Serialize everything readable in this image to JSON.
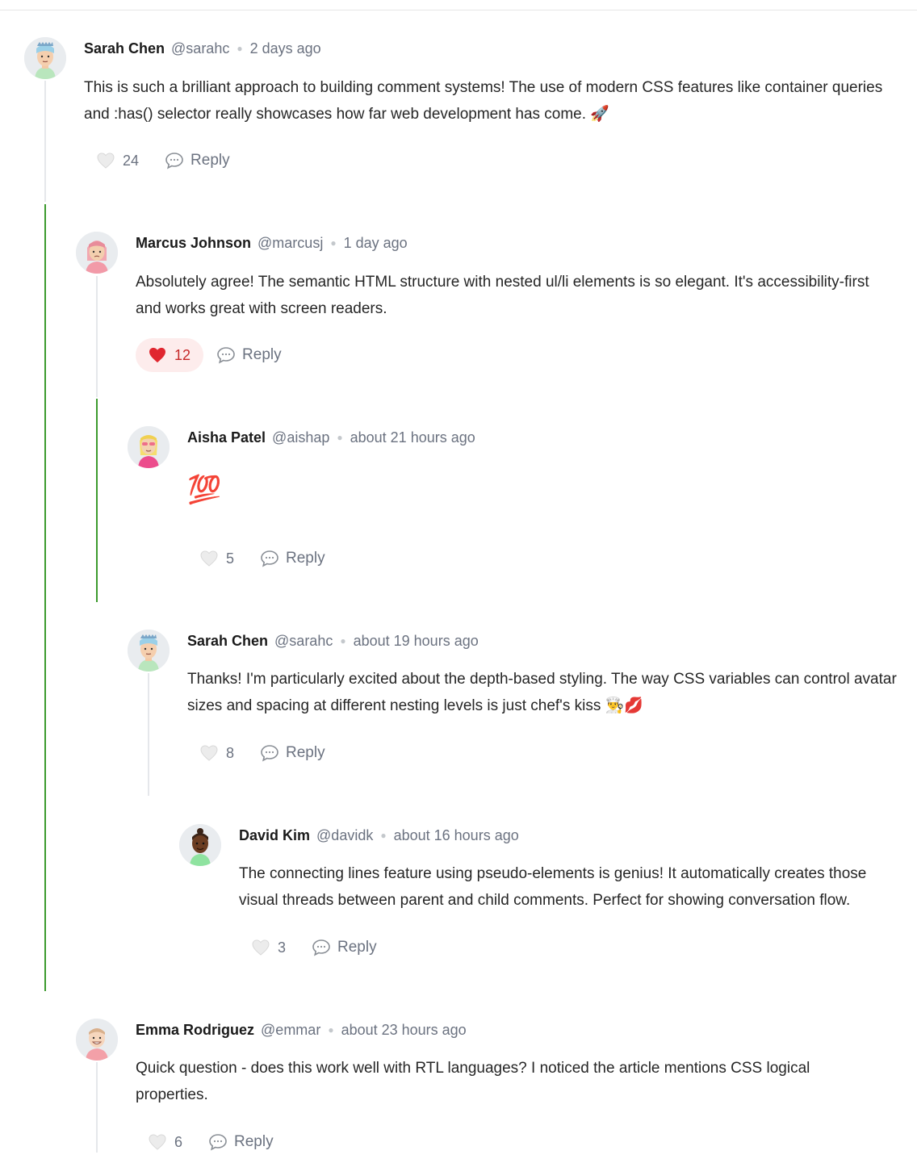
{
  "comments": [
    {
      "name": "Sarah Chen",
      "handle": "@sarahc",
      "time": "2 days ago",
      "text": "This is such a brilliant approach to building comment systems! The use of modern CSS features like container queries and :has() selector really showcases how far web development has come. 🚀",
      "likes": "24",
      "liked": false,
      "reply_label": "Reply"
    },
    {
      "name": "Marcus Johnson",
      "handle": "@marcusj",
      "time": "1 day ago",
      "text": "Absolutely agree! The semantic HTML structure with nested ul/li elements is so elegant. It's accessibility-first and works great with screen readers.",
      "likes": "12",
      "liked": true,
      "reply_label": "Reply"
    },
    {
      "name": "Aisha Patel",
      "handle": "@aishap",
      "time": "about 21 hours ago",
      "text": "💯",
      "likes": "5",
      "liked": false,
      "reply_label": "Reply"
    },
    {
      "name": "Sarah Chen",
      "handle": "@sarahc",
      "time": "about 19 hours ago",
      "text": "Thanks! I'm particularly excited about the depth-based styling. The way CSS variables can control avatar sizes and spacing at different nesting levels is just chef's kiss 👨‍🍳💋",
      "likes": "8",
      "liked": false,
      "reply_label": "Reply"
    },
    {
      "name": "David Kim",
      "handle": "@davidk",
      "time": "about 16 hours ago",
      "text": "The connecting lines feature using pseudo-elements is genius! It automatically creates those visual threads between parent and child comments. Perfect for showing conversation flow.",
      "likes": "3",
      "liked": false,
      "reply_label": "Reply"
    },
    {
      "name": "Emma Rodriguez",
      "handle": "@emmar",
      "time": "about 23 hours ago",
      "text": "Quick question - does this work well with RTL languages? I noticed the article mentions CSS logical properties.",
      "likes": "6",
      "liked": false,
      "reply_label": "Reply"
    }
  ],
  "colors": {
    "thread_line": "#e5e7eb",
    "active_thread": "#3d9a2e",
    "like_active_bg": "#fdecec",
    "like_active_text": "#c62828",
    "meta_text": "#6b7280"
  },
  "icons": {
    "like": "heart-icon",
    "reply": "speech-bubble-icon",
    "avatar_sarah": "avatar-sarah-icon",
    "avatar_marcus": "avatar-marcus-icon",
    "avatar_aisha": "avatar-aisha-icon",
    "avatar_david": "avatar-david-icon",
    "avatar_emma": "avatar-emma-icon"
  }
}
